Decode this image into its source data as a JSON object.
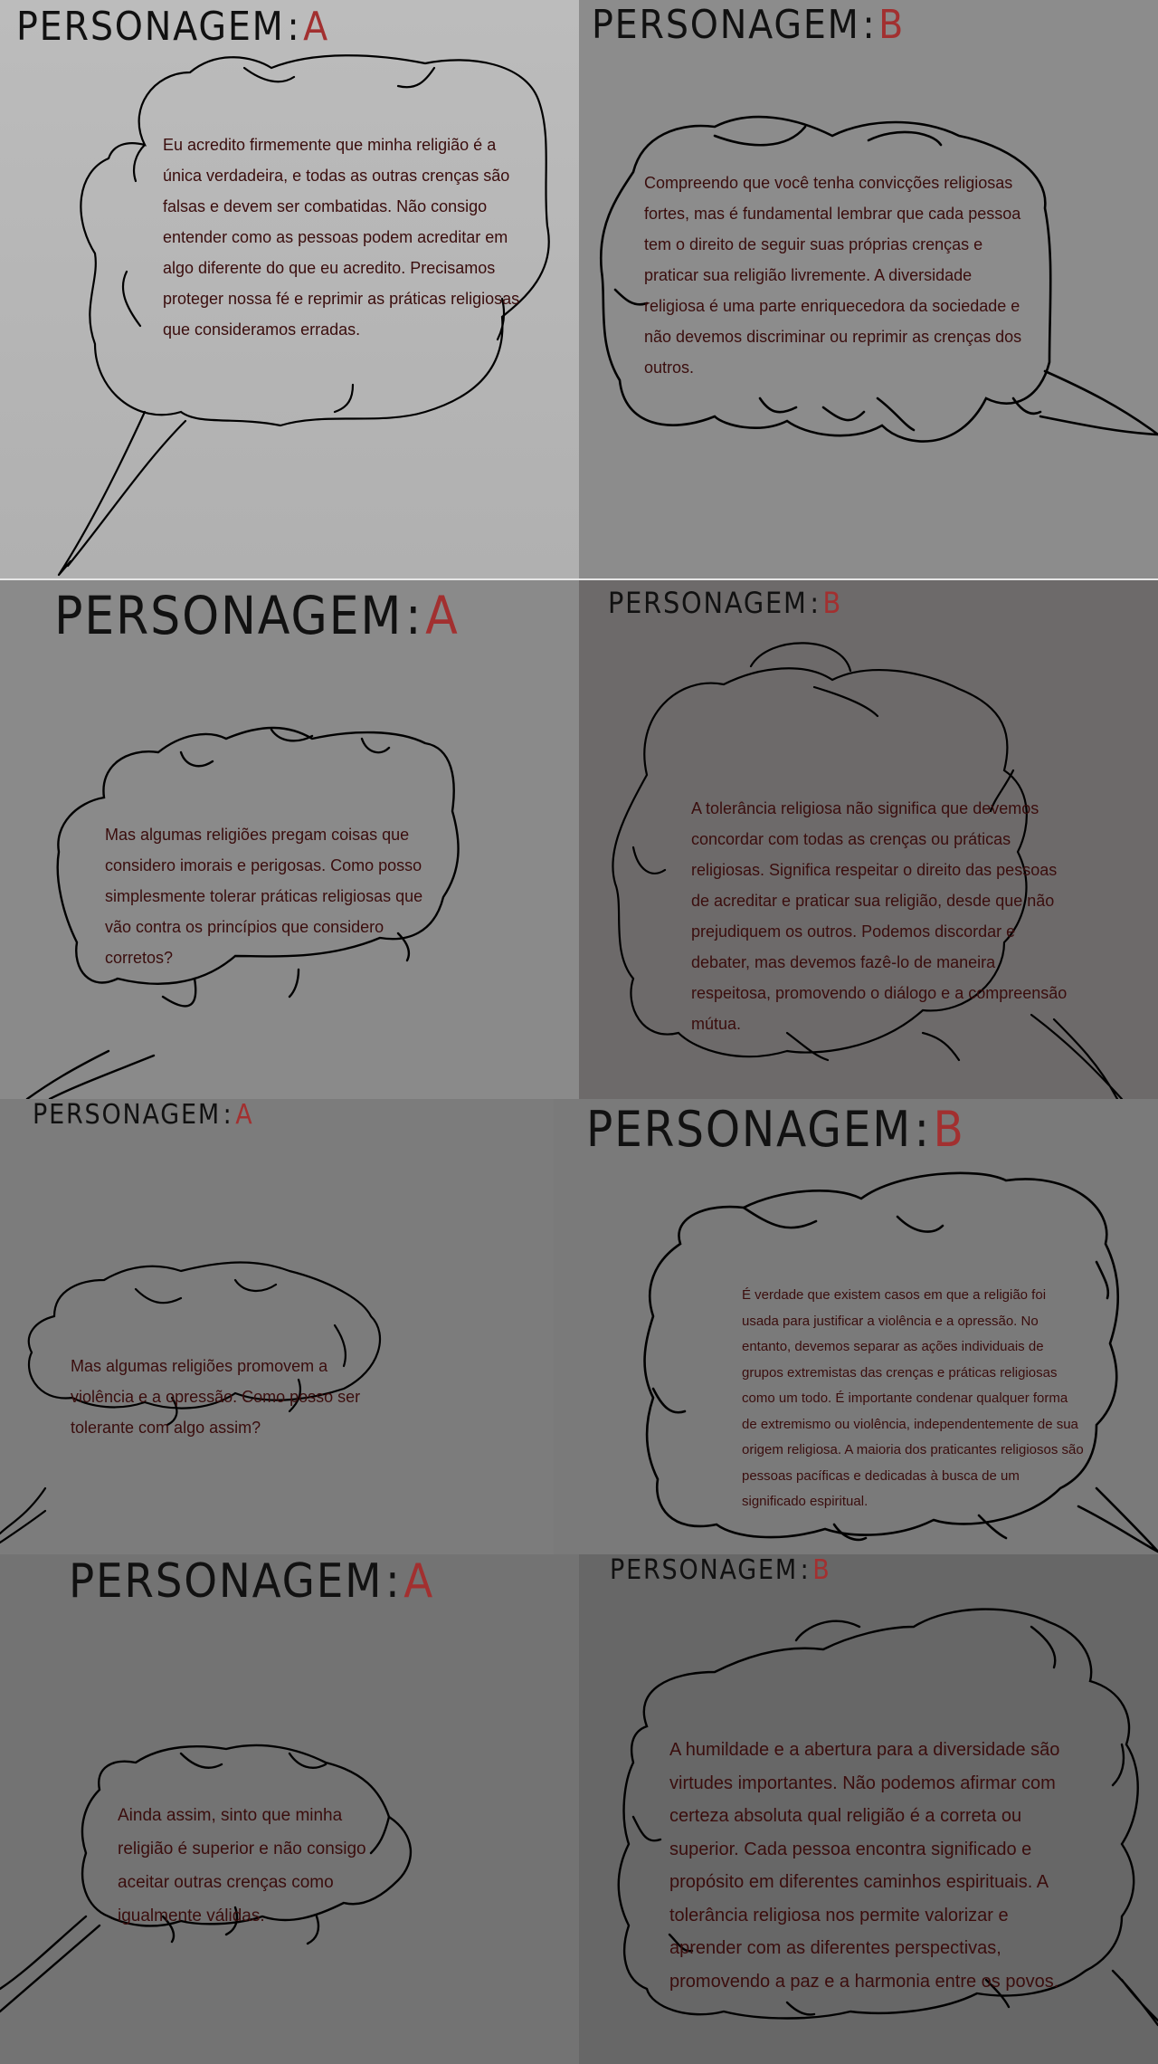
{
  "colors": {
    "speaker_letter": "#a23030",
    "speech_text": "#3a0d0d",
    "heading": "#111111",
    "bubble_stroke": "#000000"
  },
  "panels": [
    {
      "speaker_word": "PERSONAGEM",
      "separator": ":",
      "speaker": "A",
      "text": "Eu acredito firmemente que minha religião é a única verdadeira, e todas as outras crenças são falsas e devem ser combatidas. Não consigo entender como as pessoas podem acreditar em algo diferente do que eu acredito. Precisamos proteger nossa fé e reprimir as práticas religiosas que consideramos erradas."
    },
    {
      "speaker_word": "PERSONAGEM",
      "separator": ":",
      "speaker": "B",
      "text": "Compreendo que você tenha convicções religiosas fortes, mas é fundamental lembrar que cada pessoa tem o direito de seguir suas próprias crenças e praticar sua religião livremente. A diversidade religiosa é uma parte enriquecedora da sociedade e não devemos discriminar ou reprimir as crenças dos outros."
    },
    {
      "speaker_word": "PERSONAGEM",
      "separator": ":",
      "speaker": "A",
      "text": "Mas algumas religiões pregam coisas que considero imorais e perigosas. Como posso simplesmente tolerar práticas religiosas que vão contra os princípios que considero corretos?"
    },
    {
      "speaker_word": "PERSONAGEM",
      "separator": ":",
      "speaker": "B",
      "text": "A tolerância religiosa não significa que devemos concordar com todas as crenças ou práticas religiosas. Significa respeitar o direito das pessoas de acreditar e praticar sua religião, desde que não prejudiquem os outros. Podemos discordar e debater, mas devemos fazê-lo de maneira respeitosa, promovendo o diálogo e a compreensão mútua."
    },
    {
      "speaker_word": "PERSONAGEM",
      "separator": ":",
      "speaker": "A",
      "text": "Mas algumas religiões promovem a violência e a opressão. Como posso ser tolerante com algo assim?"
    },
    {
      "speaker_word": "PERSONAGEM",
      "separator": ":",
      "speaker": "B",
      "text": "É verdade que existem casos em que a religião foi usada para justificar a violência e a opressão. No entanto, devemos separar as ações individuais de grupos extremistas das crenças e práticas religiosas como um todo. É importante condenar qualquer forma de extremismo ou violência, independentemente de sua origem religiosa. A maioria dos praticantes religiosos são pessoas pacíficas e dedicadas à busca de um significado espiritual."
    },
    {
      "speaker_word": "PERSONAGEM",
      "separator": ":",
      "speaker": "A",
      "text": "Ainda assim, sinto que minha religião é superior e não consigo aceitar outras crenças como igualmente válidas."
    },
    {
      "speaker_word": "PERSONAGEM",
      "separator": ":",
      "speaker": "B",
      "text": "A humildade e a abertura para a diversidade são virtudes importantes. Não podemos afirmar com certeza absoluta qual religião é a correta ou superior. Cada pessoa encontra significado e propósito em diferentes caminhos espirituais. A tolerância religiosa nos permite valorizar e aprender com as diferentes perspectivas, promovendo a paz e a harmonia entre os povos."
    }
  ]
}
